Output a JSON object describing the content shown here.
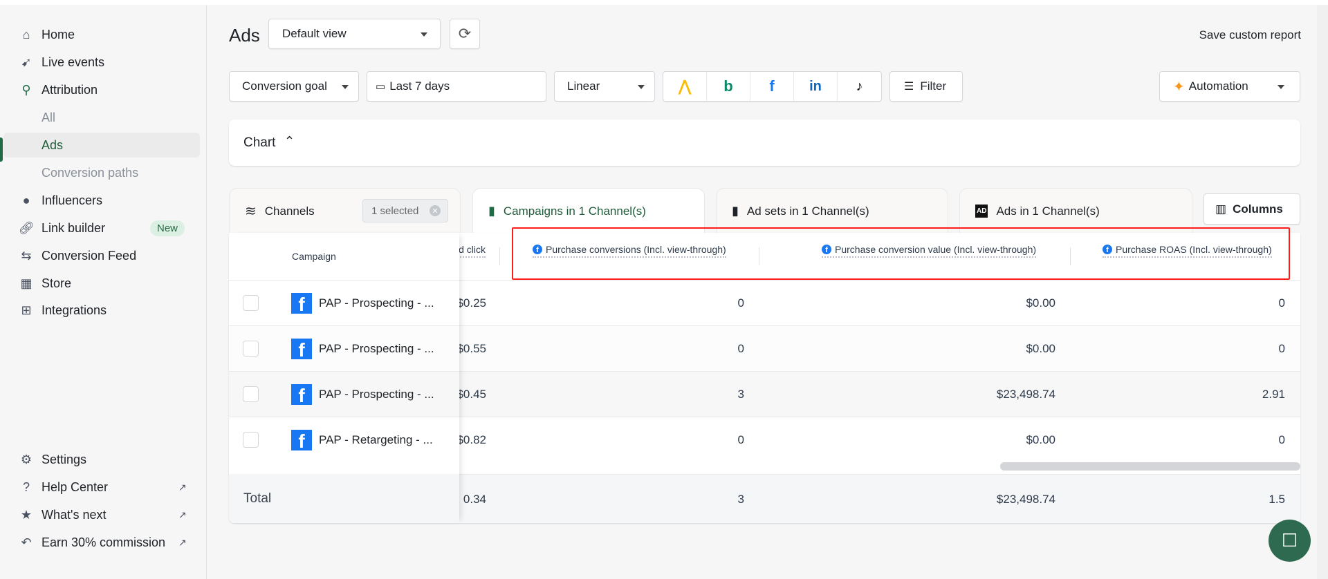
{
  "sidebar": {
    "items": [
      {
        "label": "Home",
        "icon": "home-icon"
      },
      {
        "label": "Live events",
        "icon": "cursor-click-icon"
      },
      {
        "label": "Attribution",
        "icon": "attribution-icon"
      },
      {
        "label": "All"
      },
      {
        "label": "Ads"
      },
      {
        "label": "Conversion paths"
      },
      {
        "label": "Influencers",
        "icon": "palette-icon"
      },
      {
        "label": "Link builder",
        "icon": "link-icon",
        "badge": "New"
      },
      {
        "label": "Conversion Feed",
        "icon": "arrows-icon"
      },
      {
        "label": "Store",
        "icon": "store-icon"
      },
      {
        "label": "Integrations",
        "icon": "grid-plus-icon"
      }
    ],
    "bottom": [
      {
        "label": "Settings",
        "icon": "gear-icon"
      },
      {
        "label": "Help Center",
        "icon": "question-icon"
      },
      {
        "label": "What's next",
        "icon": "star-icon"
      },
      {
        "label": "Earn 30% commission",
        "icon": "receipt-icon"
      }
    ]
  },
  "header": {
    "title": "Ads",
    "view": "Default view",
    "save": "Save custom report"
  },
  "toolbar": {
    "goal": "Conversion goal",
    "date": "Last 7 days",
    "model": "Linear",
    "filter": "Filter",
    "automation": "Automation"
  },
  "chart": {
    "label": "Chart"
  },
  "tabs": {
    "channels": "Channels",
    "selected": "1 selected",
    "campaigns": "Campaigns in 1 Channel(s)",
    "adsets": "Ad sets in 1 Channel(s)",
    "ads": "Ads in 1 Channel(s)",
    "columns": "Columns"
  },
  "table": {
    "campaign_header": "Campaign",
    "headers": [
      "d click",
      "Purchase conversions (Incl. view-through)",
      "Purchase conversion value (Incl. view-through)",
      "Purchase ROAS (Incl. view-through)"
    ],
    "rows": [
      {
        "name": "PAP - Prospecting - ...",
        "cpc": "$0.25",
        "conv": "0",
        "value": "$0.00",
        "roas": "0"
      },
      {
        "name": "PAP - Prospecting - ...",
        "cpc": "$0.55",
        "conv": "0",
        "value": "$0.00",
        "roas": "0"
      },
      {
        "name": "PAP - Prospecting - ...",
        "cpc": "$0.45",
        "conv": "3",
        "value": "$23,498.74",
        "roas": "2.91"
      },
      {
        "name": "PAP - Retargeting - ...",
        "cpc": "$0.82",
        "conv": "0",
        "value": "$0.00",
        "roas": "0"
      }
    ],
    "total": {
      "label": "Total",
      "cpc": "0.34",
      "conv": "3",
      "value": "$23,498.74",
      "roas": "1.5"
    }
  },
  "colors": {
    "accent": "#1f6b45",
    "facebook": "#1877f2",
    "highlight": "#ff0000"
  }
}
